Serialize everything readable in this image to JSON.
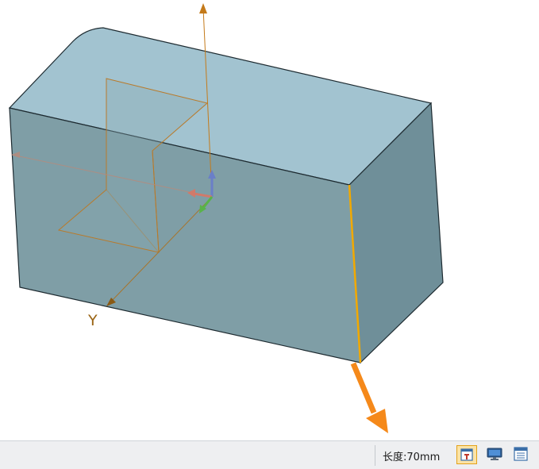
{
  "viewport": {
    "axis_y_label": "Y",
    "colors": {
      "background": "#ffffff",
      "box_top_face": "#a2c3d0",
      "box_front_face": "#7f9ea6",
      "box_side_face": "#6f8f99",
      "selected_edge": "#f2a900",
      "drag_arrow": "#f5891a",
      "sketch_lines": "#c47a1a",
      "triad_x": "#d07a6a",
      "triad_y": "#59b34a",
      "triad_z": "#6a7fc8"
    }
  },
  "status_bar": {
    "measurement": "长度:70mm",
    "buttons": [
      "properties-icon",
      "display-monitor-icon",
      "window-icon"
    ]
  }
}
